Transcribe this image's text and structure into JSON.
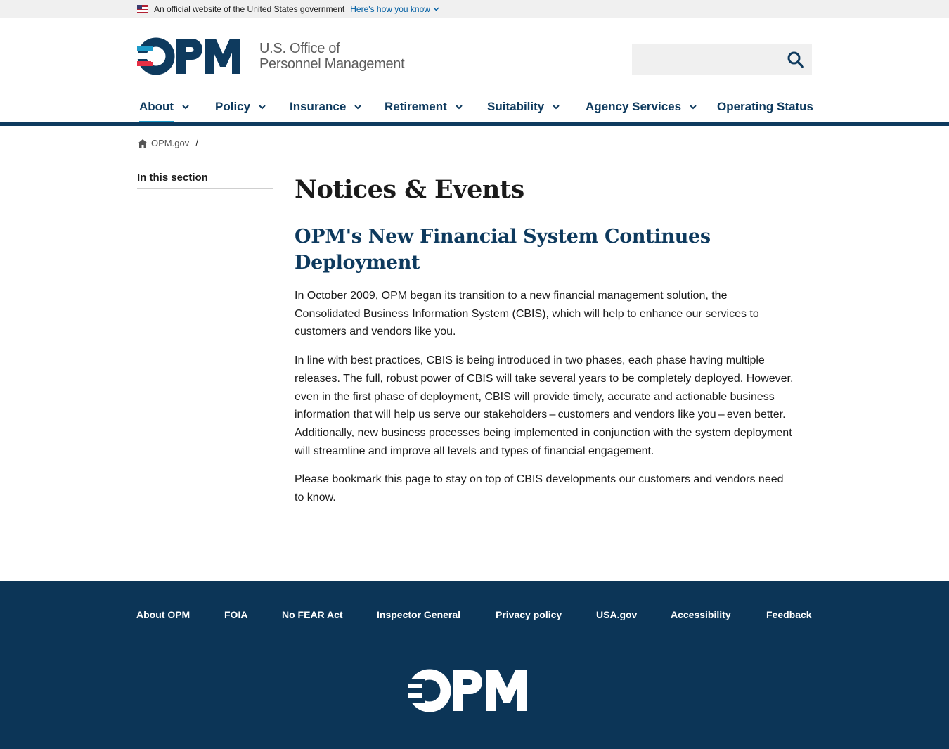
{
  "gov_banner": {
    "text": "An official website of the United States government",
    "link": "Here's how you know"
  },
  "header": {
    "logo_letters": "OPM",
    "logo_line1": "U.S. Office of",
    "logo_line2": "Personnel Management",
    "search_placeholder": ""
  },
  "nav": {
    "items": [
      {
        "label": "About",
        "has_dropdown": true,
        "active": true
      },
      {
        "label": "Policy",
        "has_dropdown": true
      },
      {
        "label": "Insurance",
        "has_dropdown": true
      },
      {
        "label": "Retirement",
        "has_dropdown": true
      },
      {
        "label": "Suitability",
        "has_dropdown": true
      },
      {
        "label": "Agency Services",
        "has_dropdown": true
      },
      {
        "label": "Operating Status",
        "has_dropdown": false
      }
    ]
  },
  "breadcrumb": {
    "home": "OPM.gov",
    "separator": "/"
  },
  "sidebar": {
    "title": "In this section"
  },
  "main": {
    "page_title": "Notices & Events",
    "article_title": "OPM's New Financial System Continues Deployment",
    "paragraphs": [
      "In October 2009, OPM began its transition to a new financial management solution, the Consolidated Business Information System (CBIS), which will help to enhance our services to customers and vendors like you.",
      "In line with best practices, CBIS is being introduced in two phases, each phase having multiple releases. The full, robust power of CBIS will take several years to be completely deployed. However, even in the first phase of deployment, CBIS will provide timely, accurate and actionable business information that will help us serve our stakeholders – customers and vendors like you – even better. Additionally, new business processes being implemented in conjunction with the system deployment will streamline and improve all levels and types of financial engagement.",
      "Please bookmark this page to stay on top of CBIS developments our customers and vendors need to know."
    ]
  },
  "footer": {
    "links": [
      "About OPM",
      "FOIA",
      "No FEAR Act",
      "Inspector General",
      "Privacy policy",
      "USA.gov",
      "Accessibility",
      "Feedback"
    ],
    "logo_letters": "OPM"
  },
  "colors": {
    "navy": "#0e3a5e",
    "footer_bg": "#0c3557",
    "accent_blue": "#1f9bc9",
    "accent_red": "#e52f45",
    "link_blue": "#005ea2"
  }
}
